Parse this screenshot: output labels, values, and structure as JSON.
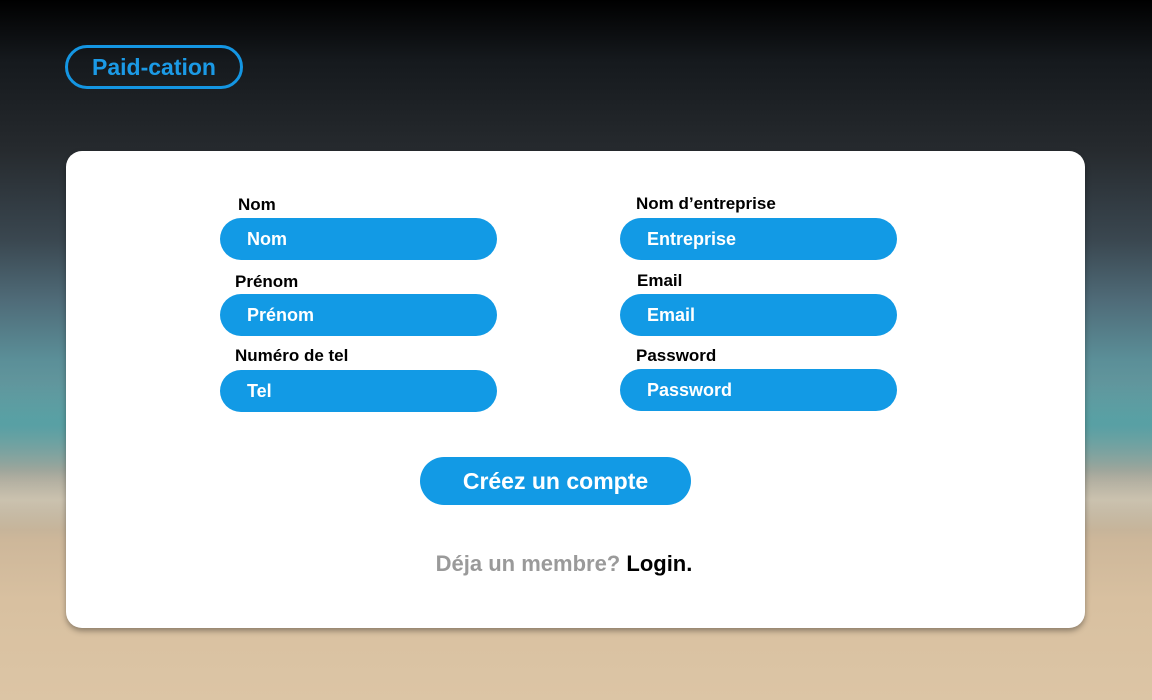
{
  "brand": {
    "logo_label": "Paid-cation",
    "accent_color": "#129ae5"
  },
  "form": {
    "left_fields": [
      {
        "label": "Nom",
        "placeholder": "Nom"
      },
      {
        "label": "Prénom",
        "placeholder": "Prénom"
      },
      {
        "label": "Numéro de tel",
        "placeholder": "Tel"
      }
    ],
    "right_fields": [
      {
        "label": "Nom d’entreprise",
        "placeholder": "Entreprise"
      },
      {
        "label": "Email",
        "placeholder": "Email"
      },
      {
        "label": "Password",
        "placeholder": "Password"
      }
    ],
    "submit_label": "Créez un compte"
  },
  "footer": {
    "member_prompt": "Déja un membre?",
    "login_label": "Login."
  }
}
